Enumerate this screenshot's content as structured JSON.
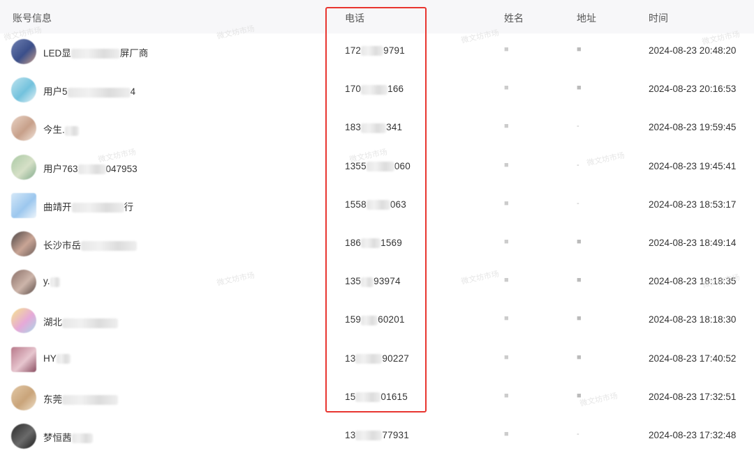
{
  "headers": {
    "account": "账号信息",
    "phone": "电话",
    "name": "姓名",
    "address": "地址",
    "time": "时间"
  },
  "watermark": "微文坊市场",
  "rows": [
    {
      "acc_a": "LED显",
      "acc_b": "屏厂商",
      "phone_a": "172",
      "phone_b": "9791",
      "name": "■",
      "addr": "■",
      "time": "2024-08-23 20:48:20",
      "avatar": [
        "#6e7fb0",
        "#3b4f8a",
        "#c9a08c"
      ]
    },
    {
      "acc_a": "用户5",
      "acc_b": "4",
      "phone_a": "170",
      "phone_b": "166",
      "name": "■",
      "addr": "■",
      "time": "2024-08-23 20:16:53",
      "avatar": [
        "#bfe3ee",
        "#73c2dd",
        "#e8f3f6"
      ]
    },
    {
      "acc_a": "今生.",
      "acc_b": "",
      "phone_a": "183",
      "phone_b": "341",
      "name": "■",
      "addr": "-",
      "time": "2024-08-23 19:59:45",
      "avatar": [
        "#e9d3c5",
        "#c7a08a",
        "#f3e6dc"
      ]
    },
    {
      "acc_a": "用户763",
      "acc_b": "047953",
      "phone_a": "1355",
      "phone_b": "060",
      "name": "■",
      "addr": "-",
      "time": "2024-08-23 19:45:41",
      "avatar": [
        "#a9c9a4",
        "#d6e0c7",
        "#7fa98a"
      ]
    },
    {
      "acc_a": "曲靖开",
      "acc_b": "行",
      "phone_a": "1558",
      "phone_b": "063",
      "name": "■",
      "addr": "-",
      "time": "2024-08-23 18:53:17",
      "avatar": [
        "#d5e8f8",
        "#9cc7ee",
        "#eef5fb"
      ]
    },
    {
      "acc_a": "长沙市岳",
      "acc_b": "",
      "phone_a": "186",
      "phone_b": "1569",
      "name": "■",
      "addr": "■",
      "time": "2024-08-23 18:49:14",
      "avatar": [
        "#4a4444",
        "#c9a596",
        "#6b5c58"
      ]
    },
    {
      "acc_a": "y.",
      "acc_b": "",
      "phone_a": "135",
      "phone_b": "93974",
      "name": "■",
      "addr": "■",
      "time": "2024-08-23 18:18:35",
      "avatar": [
        "#8a6f67",
        "#cdb5aa",
        "#5a4a45"
      ]
    },
    {
      "acc_a": "湖北",
      "acc_b": "",
      "phone_a": "159",
      "phone_b": "60201",
      "name": "■",
      "addr": "■",
      "time": "2024-08-23 18:18:30",
      "avatar": [
        "#f6e58c",
        "#e6a9d8",
        "#a7d8e8"
      ]
    },
    {
      "acc_a": "HY",
      "acc_b": "",
      "phone_a": "13",
      "phone_b": "90227",
      "name": "■",
      "addr": "■",
      "time": "2024-08-23 17:40:52",
      "avatar": [
        "#b8798a",
        "#e7c6cf",
        "#8b4f62"
      ]
    },
    {
      "acc_a": "东莞",
      "acc_b": "",
      "phone_a": "15",
      "phone_b": "01615",
      "name": "■",
      "addr": "■",
      "time": "2024-08-23 17:32:51",
      "avatar": [
        "#e2c8a6",
        "#c9a47a",
        "#efe0c8"
      ]
    },
    {
      "acc_a": "梦恒茜",
      "acc_b": "",
      "phone_a": "13",
      "phone_b": "77931",
      "name": "■",
      "addr": "-",
      "time": "2024-08-23 17:32:48",
      "avatar": [
        "#2b2b2b",
        "#6a6a6a",
        "#1b1b1b"
      ]
    }
  ]
}
